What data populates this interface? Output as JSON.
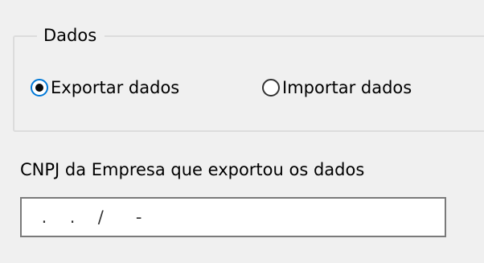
{
  "group": {
    "legend": "Dados",
    "options": [
      {
        "label": "Exportar dados",
        "selected": true
      },
      {
        "label": "Importar dados",
        "selected": false
      }
    ]
  },
  "cnpj": {
    "label": "CNPJ da Empresa que exportou os dados",
    "mask": " .  .  /   -"
  }
}
